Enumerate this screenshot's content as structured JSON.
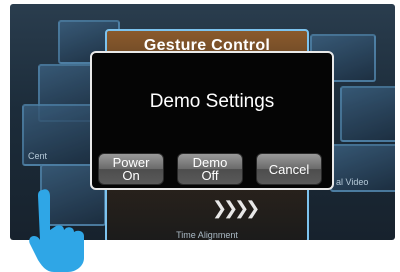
{
  "background": {
    "title": "Gesture Control",
    "left_tile_label": "Cent",
    "right_tile_label": "al Video",
    "footer_label": "Time Alignment"
  },
  "dialog": {
    "title": "Demo Settings",
    "buttons": {
      "power_on": "Power On",
      "demo_off": "Demo Off",
      "cancel": "Cancel"
    }
  },
  "colors": {
    "dialog_bg": "#050505",
    "dialog_border": "#e9e9e9",
    "accent": "#2fa6e6"
  }
}
